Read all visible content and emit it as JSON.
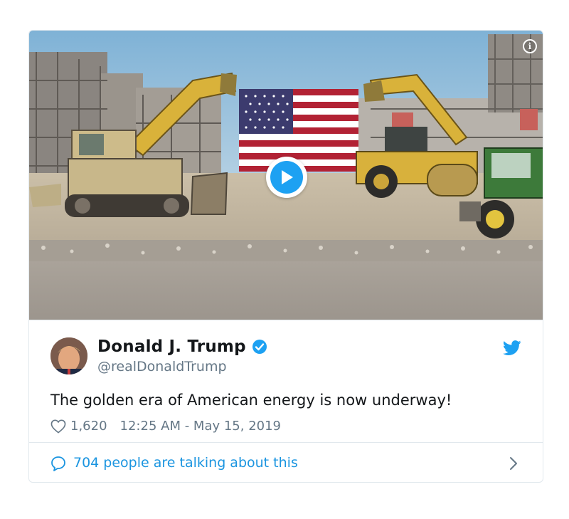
{
  "tweet": {
    "display_name": "Donald J. Trump",
    "handle": "@realDonaldTrump",
    "text": "The golden era of American energy is now underway!",
    "likes": "1,620",
    "timestamp": "12:25 AM - May 15, 2019",
    "verified": true
  },
  "footer": {
    "talking": "704 people are talking about this"
  },
  "media": {
    "type": "video",
    "content": "construction site with american flag and heavy machinery"
  },
  "icons": {
    "play": "play-icon",
    "info": "info-icon",
    "verified": "verified-badge-icon",
    "bird": "twitter-bird-icon",
    "heart": "heart-icon",
    "bubble": "speech-bubble-icon",
    "chevron": "chevron-right-icon"
  },
  "colors": {
    "accent": "#1da1f2",
    "link": "#1b95e0",
    "muted": "#657786",
    "border": "#e1e8ed"
  }
}
